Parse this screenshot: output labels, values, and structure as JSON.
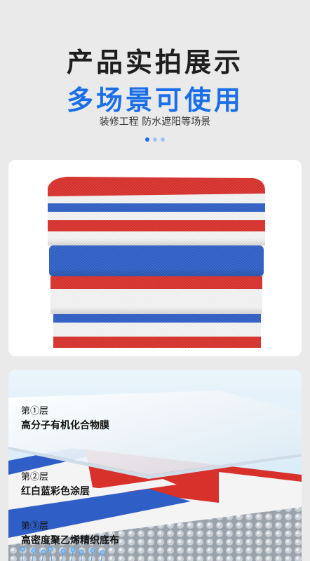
{
  "header": {
    "title_line1": "产品实拍展示",
    "title_line2": "多场景可使用",
    "subtitle": "装修工程 防水遮阳等场景"
  },
  "carousel": {
    "total": 3,
    "active_index": 0,
    "active_color": "#1a6fe8",
    "inactive_color": "#9fc5f5"
  },
  "colors": {
    "brand_blue": "#1a6fe8",
    "stripe_red": "#d8312c",
    "stripe_blue": "#2f5fc6",
    "stripe_white": "#f4f4f4"
  },
  "layers": [
    {
      "number": "第①层",
      "name": "高分子有机化合物膜"
    },
    {
      "number": "第②层",
      "name": "红白蓝彩色涂层"
    },
    {
      "number": "第③层",
      "name": "高密度聚乙烯精织底布"
    }
  ]
}
